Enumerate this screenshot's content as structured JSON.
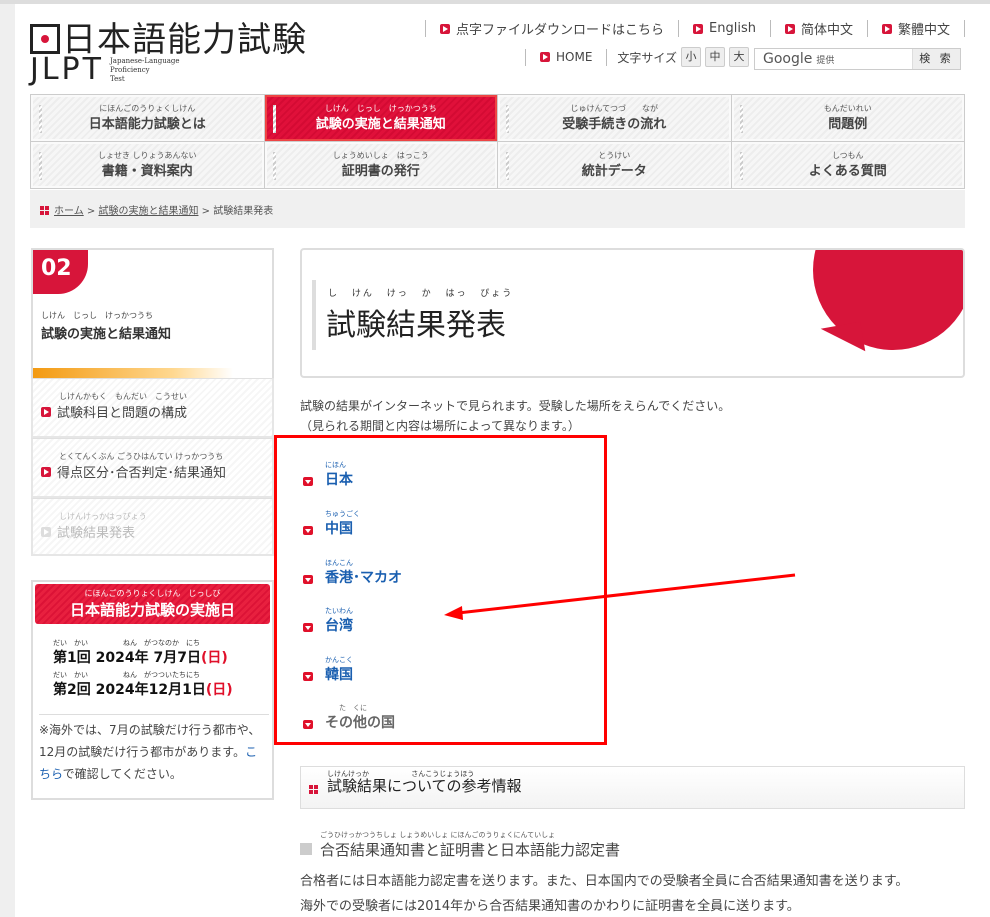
{
  "header": {
    "logo_jp": "日本語能力試験",
    "logo_en": "JLPT",
    "logo_sub": [
      "Japanese-Language",
      "Proficiency",
      "Test"
    ],
    "top_links": [
      "点字ファイルダウンロードはこちら",
      "English",
      "简体中文",
      "繁體中文"
    ],
    "home": "HOME",
    "font_size_label": "文字サイズ",
    "font_sizes": [
      "小",
      "中",
      "大"
    ],
    "search": {
      "brand": "Google",
      "provided": "提供",
      "button": "検 索"
    }
  },
  "nav": [
    {
      "ruby": "にほんごのうりょくしけん",
      "label": "日本語能力試験とは"
    },
    {
      "ruby": "しけん　じっし　けっかつうち",
      "label": "試験の実施と結果通知",
      "active": true
    },
    {
      "ruby": "じゅけんてつづ　　なが",
      "label": "受験手続きの流れ"
    },
    {
      "ruby": "もんだいれい",
      "label": "問題例"
    },
    {
      "ruby": "しょせき しりょうあんない",
      "label": "書籍・資料案内"
    },
    {
      "ruby": "しょうめいしょ　はっこう",
      "label": "証明書の発行"
    },
    {
      "ruby": "とうけい",
      "label": "統計データ"
    },
    {
      "ruby": "しつもん",
      "label": "よくある質問"
    }
  ],
  "breadcrumb": [
    "ホーム",
    "試験の実施と結果通知",
    "試験結果発表"
  ],
  "sidebar": {
    "number": "02",
    "ruby": "しけん　じっし　けっかつうち",
    "title": "試験の実施と結果通知",
    "items": [
      {
        "ruby": "しけんかもく　もんだい　こうせい",
        "label": "試験科目と問題の構成"
      },
      {
        "ruby": "とくてんくぶん ごうひはんてい けっかつうち",
        "label": "得点区分･合否判定･結果通知"
      },
      {
        "ruby": "しけんけっかはっぴょう",
        "label": "試験結果発表"
      }
    ],
    "dates": {
      "ruby": "にほんごのうりょくしけん　じっしび",
      "title": "日本語能力試験の実施日",
      "rows": [
        {
          "ruby": "だい　かい　　　　　ねん　がつなのか　にち",
          "round": "第1回",
          "year": "2024年",
          "date": "7月7日",
          "day": "(日)"
        },
        {
          "ruby": "だい　かい　　　　　ねん　がつついたちにち",
          "round": "第2回",
          "year": "2024年",
          "date": "12月1日",
          "day": "(日)"
        }
      ],
      "note_before": "※海外では、7月の試験だけ行う都市や、12月の試験だけ行う都市があります。",
      "note_link": "こちら",
      "note_after": "で確認してください。"
    }
  },
  "main": {
    "title_ruby": "し けん けっ か はっ ぴょう",
    "title": "試験結果発表",
    "intro": [
      "試験の結果がインターネットで見られます。受験した場所をえらんでください。",
      "（見られる期間と内容は場所によって異なります。）"
    ],
    "countries": [
      {
        "ruby": "にほん",
        "label": "日本"
      },
      {
        "ruby": "ちゅうごく",
        "label": "中国"
      },
      {
        "ruby": "ほんこん",
        "label": "香港･マカオ"
      },
      {
        "ruby": "たいわん",
        "label": "台湾"
      },
      {
        "ruby": "かんこく",
        "label": "韓国"
      },
      {
        "ruby": "　　た　くに",
        "label": "その他の国"
      }
    ],
    "reference": {
      "ruby": "しけんけっか さんこうじょうほう",
      "title": "試験結果についての参考情報"
    },
    "subheading": {
      "ruby": "ごうひけっかつうちしょ しょうめいしょ にほんごのうりょくにんていしょ",
      "title": "合否結果通知書と証明書と日本語能力認定書"
    },
    "paragraphs": [
      "合格者には日本語能力認定書を送ります。また、日本国内での受験者全員に合否結果通知書を送ります。",
      "海外での受験者には2014年から合否結果通知書のかわりに証明書を全員に送ります。"
    ]
  },
  "colors": {
    "brand_red": "#d7153a",
    "link_blue": "#1a5fb0",
    "annotation_red": "#ff0000"
  }
}
